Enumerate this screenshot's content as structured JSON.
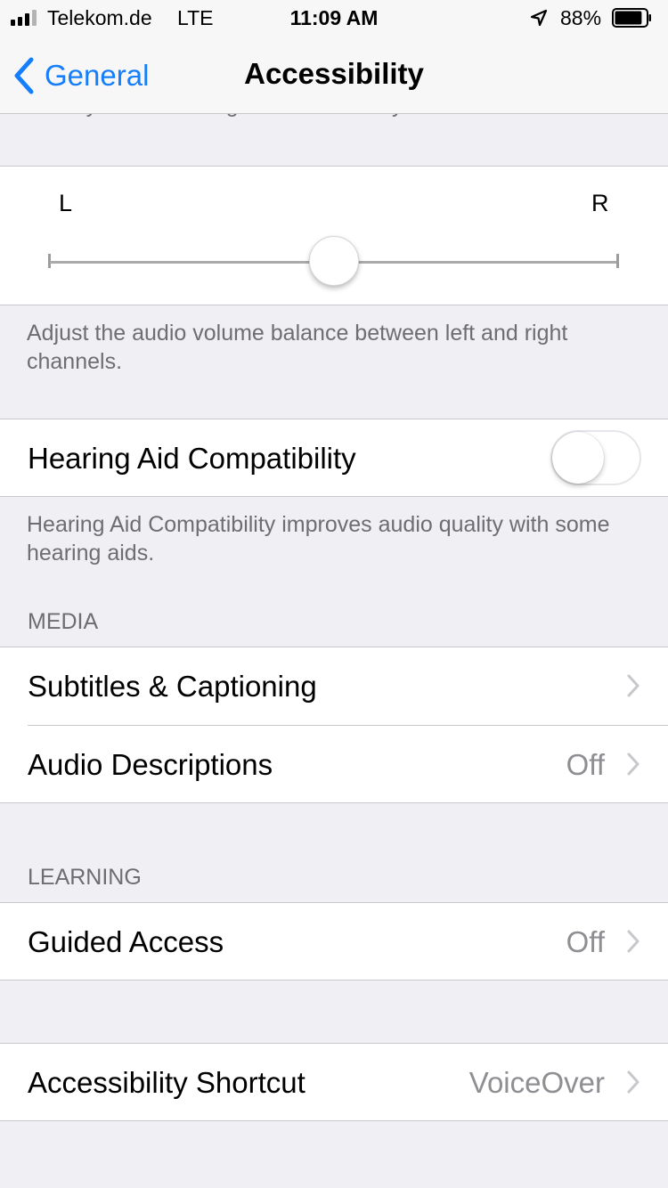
{
  "status_bar": {
    "carrier": "Telekom.de",
    "network": "LTE",
    "time": "11:09 AM",
    "battery_percent": "88%",
    "signal_bars_on": 3,
    "signal_bars_total": 4,
    "battery_level": 0.88,
    "icons": [
      "signal-icon",
      "location-icon",
      "battery-icon"
    ]
  },
  "nav": {
    "back_label": "General",
    "title": "Accessibility",
    "accent_color": "#157efb"
  },
  "cutoff_text": "when you are holding the receiver to your ear.",
  "balance": {
    "left_label": "L",
    "right_label": "R",
    "position": 0.5,
    "footer": "Adjust the audio volume balance between left and right channels."
  },
  "hearing_aid": {
    "label": "Hearing Aid Compatibility",
    "enabled": false,
    "footer": "Hearing Aid Compatibility improves audio quality with some hearing aids."
  },
  "media": {
    "header": "MEDIA",
    "items": [
      {
        "label": "Subtitles & Captioning",
        "value": ""
      },
      {
        "label": "Audio Descriptions",
        "value": "Off"
      }
    ]
  },
  "learning": {
    "header": "LEARNING",
    "items": [
      {
        "label": "Guided Access",
        "value": "Off"
      }
    ]
  },
  "shortcut": {
    "label": "Accessibility Shortcut",
    "value": "VoiceOver"
  }
}
